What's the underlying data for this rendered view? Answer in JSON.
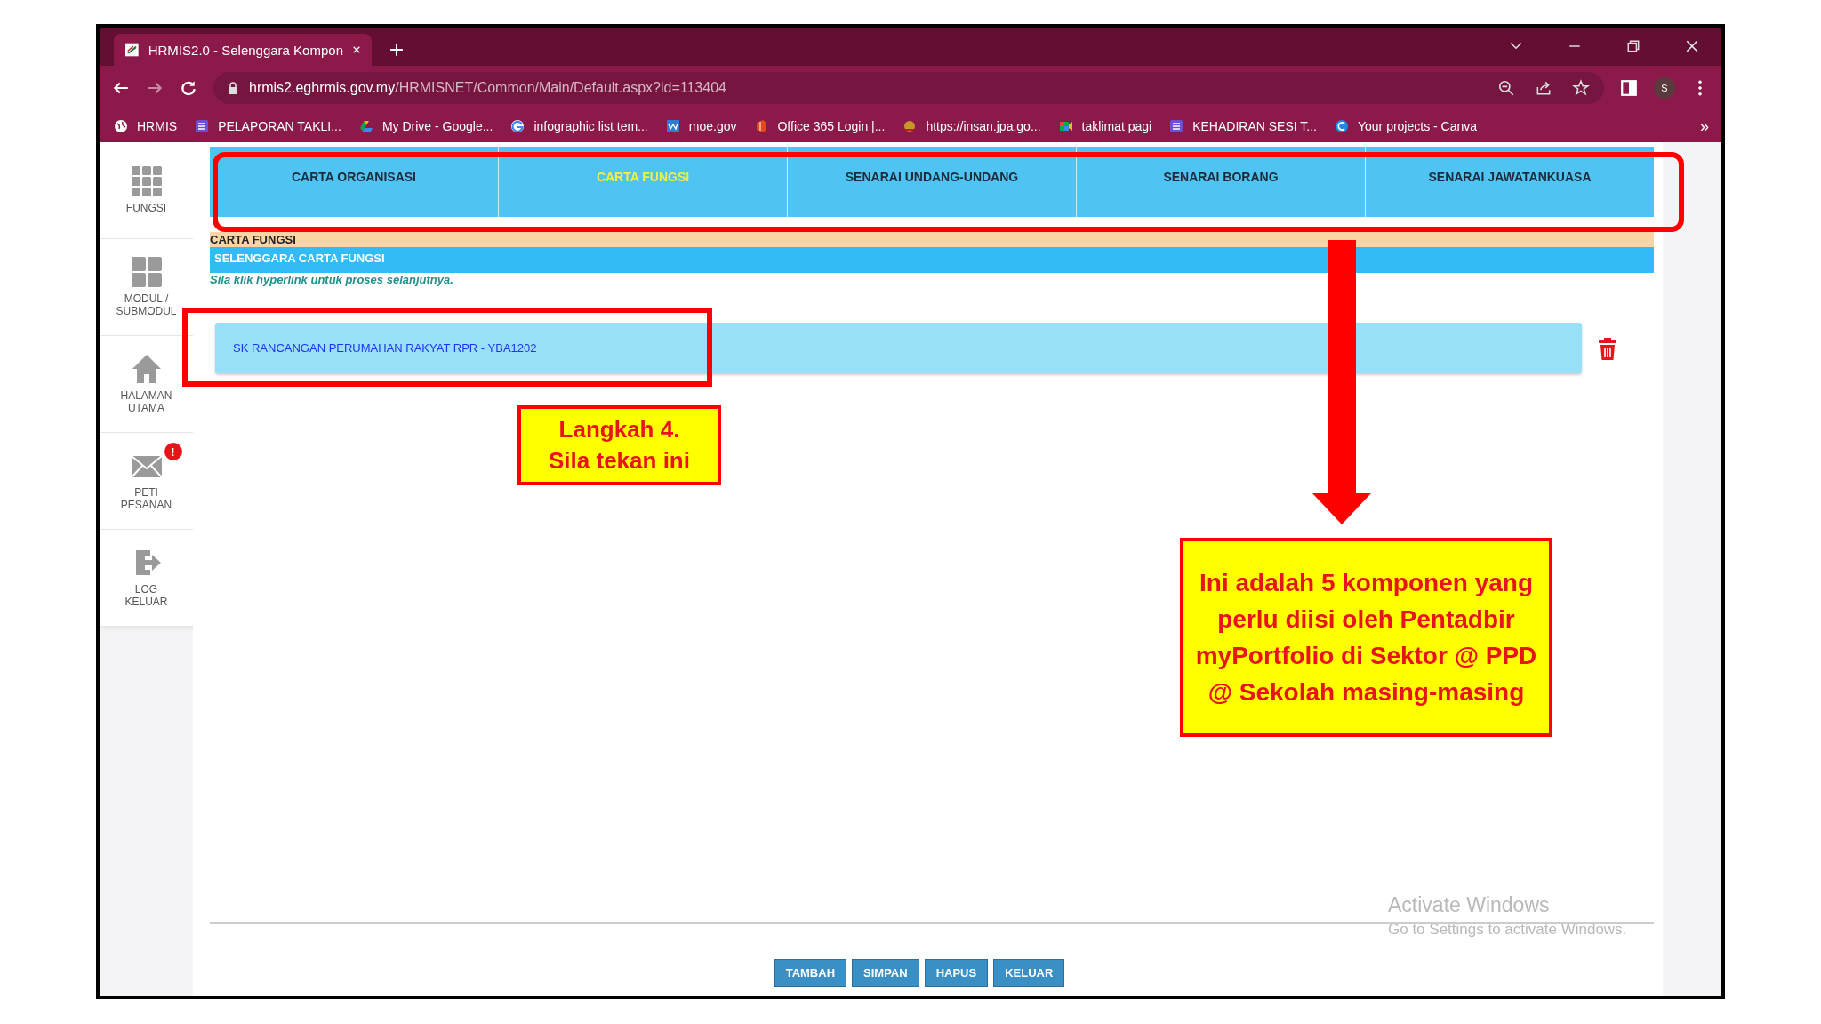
{
  "browser": {
    "tab_title": "HRMIS2.0 - Selenggara Kompon",
    "url_host": "hrmis2.eghrmis.gov.my",
    "url_path": "/HRMISNET/Common/Main/Default.aspx?id=113404",
    "profile_initial": "S",
    "bookmarks": [
      "HRMIS",
      "PELAPORAN TAKLI...",
      "My Drive - Google...",
      "infographic list tem...",
      "moe.gov",
      "Office 365 Login |...",
      "https://insan.jpa.go...",
      "taklimat pagi",
      "KEHADIRAN SESI T...",
      "Your projects - Canva"
    ],
    "bookmarks_more": "»"
  },
  "sidebar": {
    "items": [
      {
        "label": "FUNGSI"
      },
      {
        "label": "MODUL /\nSUBMODUL"
      },
      {
        "label": "HALAMAN\nUTAMA"
      },
      {
        "label": "PETI\nPESANAN",
        "badge": "!"
      },
      {
        "label": "LOG\nKELUAR"
      }
    ]
  },
  "tabs": [
    {
      "label": "CARTA ORGANISASI",
      "selected": false
    },
    {
      "label": "CARTA FUNGSI",
      "selected": true
    },
    {
      "label": "SENARAI UNDANG-UNDANG",
      "selected": false
    },
    {
      "label": "SENARAI BORANG",
      "selected": false
    },
    {
      "label": "SENARAI JAWATANKUASA",
      "selected": false
    }
  ],
  "section_title": "CARTA FUNGSI",
  "subsection_title": "SELENGGARA CARTA FUNGSI",
  "hint": "Sila klik hyperlink untuk proses selanjutnya.",
  "items": [
    {
      "label": "SK RANCANGAN PERUMAHAN RAKYAT RPR - YBA1202"
    }
  ],
  "buttons": [
    "TAMBAH",
    "SIMPAN",
    "HAPUS",
    "KELUAR"
  ],
  "os_notice": {
    "title": "Activate Windows",
    "subtitle": "Go to Settings to activate Windows."
  },
  "annotations": {
    "step": "Langkah 4.\nSila tekan ini",
    "note": "Ini adalah 5 komponen yang perlu diisi oleh Pentadbir myPortfolio di Sektor @ PPD @ Sekolah masing-masing"
  }
}
